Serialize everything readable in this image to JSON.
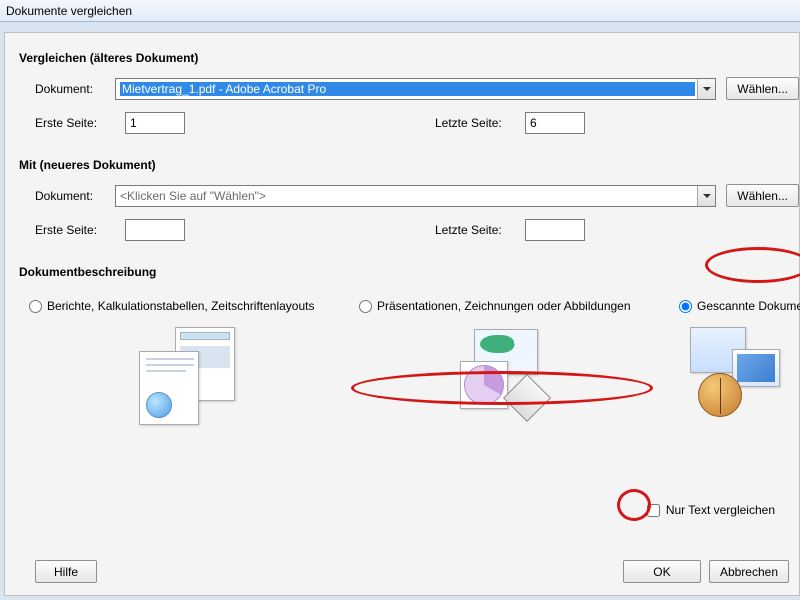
{
  "window": {
    "title": "Dokumente vergleichen"
  },
  "sections": {
    "older": {
      "title": "Vergleichen (älteres Dokument)",
      "document_label": "Dokument:",
      "document_value": "Mietvertrag_1.pdf - Adobe Acrobat Pro",
      "choose_label": "Wählen...",
      "first_page_label": "Erste Seite:",
      "first_page_value": "1",
      "last_page_label": "Letzte Seite:",
      "last_page_value": "6"
    },
    "newer": {
      "title": "Mit (neueres Dokument)",
      "document_label": "Dokument:",
      "document_placeholder": "<Klicken Sie auf \"Wählen\">",
      "choose_label": "Wählen...",
      "first_page_label": "Erste Seite:",
      "first_page_value": "",
      "last_page_label": "Letzte Seite:",
      "last_page_value": ""
    },
    "description": {
      "title": "Dokumentbeschreibung",
      "opt_reports": "Berichte, Kalkulationstabellen, Zeitschriftenlayouts",
      "opt_drawings": "Präsentationen, Zeichnungen oder Abbildungen",
      "opt_scans": "Gescannte Dokumente",
      "selected": "scans",
      "text_only_label": "Nur Text vergleichen",
      "text_only_checked": false
    }
  },
  "buttons": {
    "help": "Hilfe",
    "ok": "OK",
    "cancel": "Abbrechen"
  }
}
